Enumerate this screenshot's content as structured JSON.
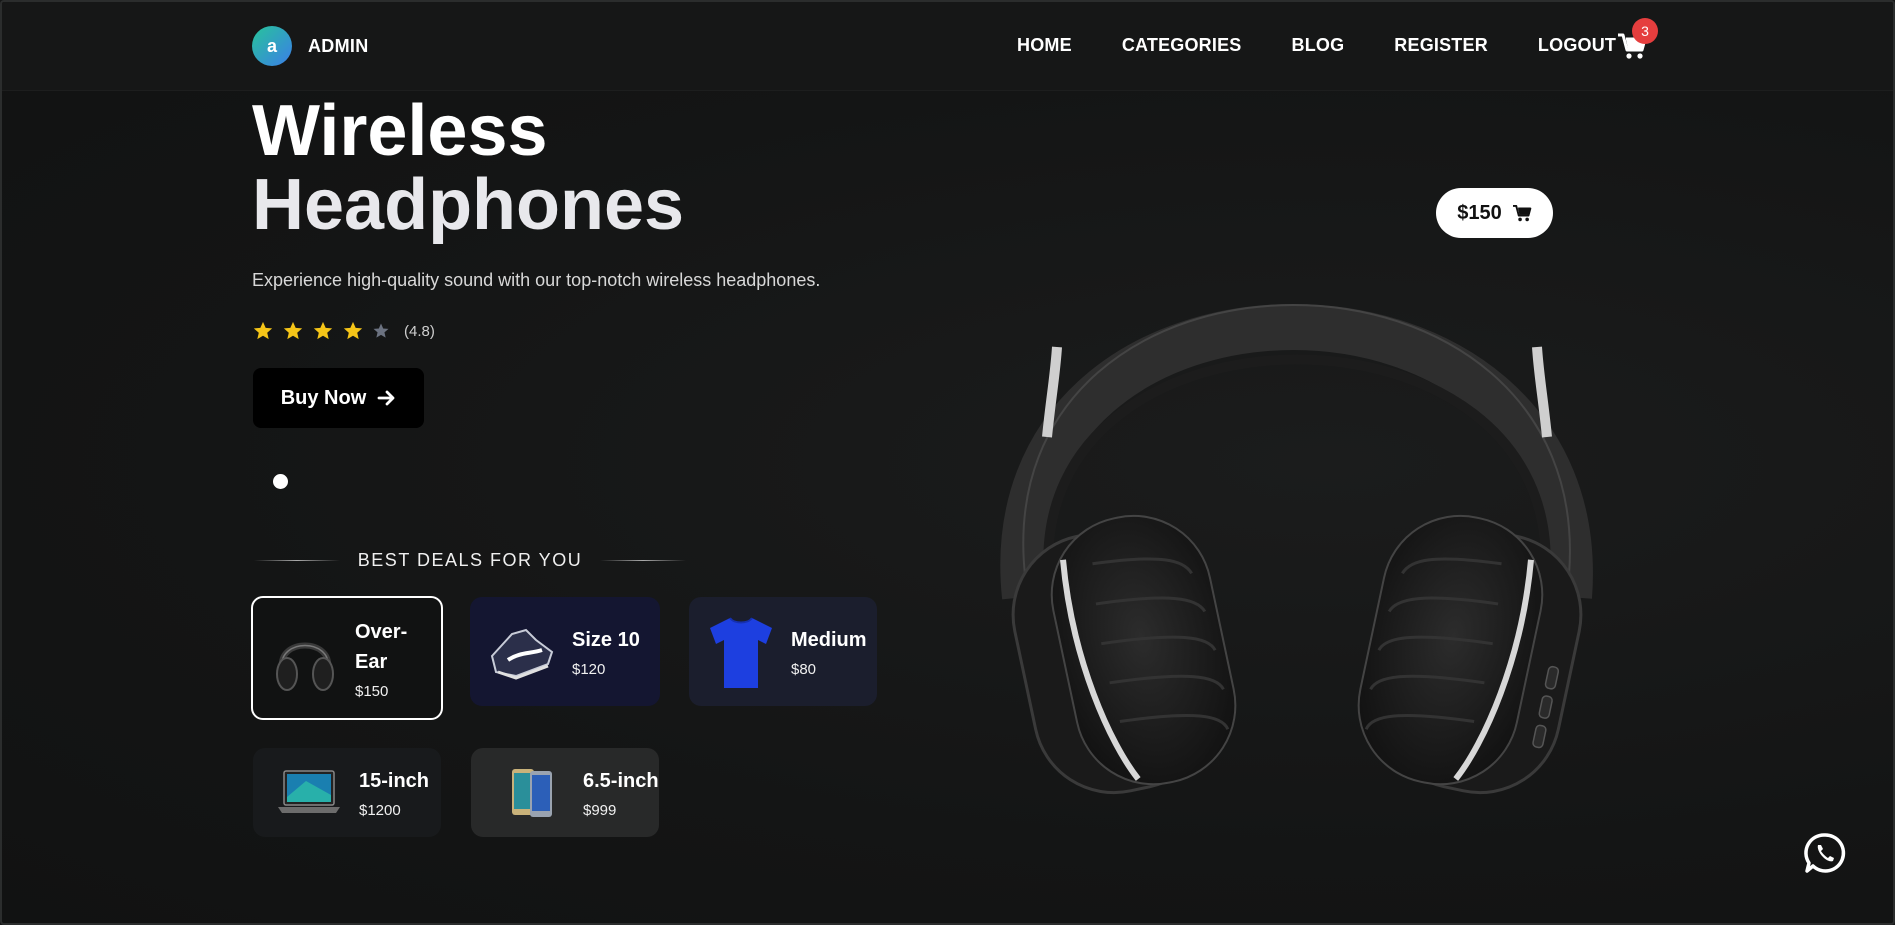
{
  "brand": {
    "avatar_letter": "a",
    "name": "ADMIN"
  },
  "nav": {
    "items": [
      "HOME",
      "CATEGORIES",
      "BLOG",
      "REGISTER",
      "LOGOUT"
    ]
  },
  "cart": {
    "count": "3",
    "icon": "cart-icon"
  },
  "hero": {
    "title_line1": "Wireless",
    "title_line2": "Headphones",
    "subtitle": "Experience high-quality sound with our top-notch wireless headphones.",
    "rating": {
      "stars_filled": 4,
      "stars_total": 5,
      "value": "(4.8)"
    },
    "buy_label": "Buy Now",
    "price_tag": "$150",
    "slider_dots": 1
  },
  "deals": {
    "heading": "BEST DEALS FOR YOU",
    "items": [
      {
        "name": "Over-Ear",
        "price": "$150",
        "image": "headphones",
        "selected": true
      },
      {
        "name": "Size 10",
        "price": "$120",
        "image": "sneaker"
      },
      {
        "name": "Medium",
        "price": "$80",
        "image": "tshirt"
      },
      {
        "name": "15-inch",
        "price": "$1200",
        "image": "laptop"
      },
      {
        "name": "6.5-inch",
        "price": "$999",
        "image": "smartphones"
      }
    ]
  },
  "colors": {
    "background": "#151616",
    "badge": "#e53e3e",
    "star": "#f5c518",
    "star_empty": "#6b7280",
    "button": "#000000"
  },
  "floating": {
    "icon": "whatsapp-icon"
  }
}
